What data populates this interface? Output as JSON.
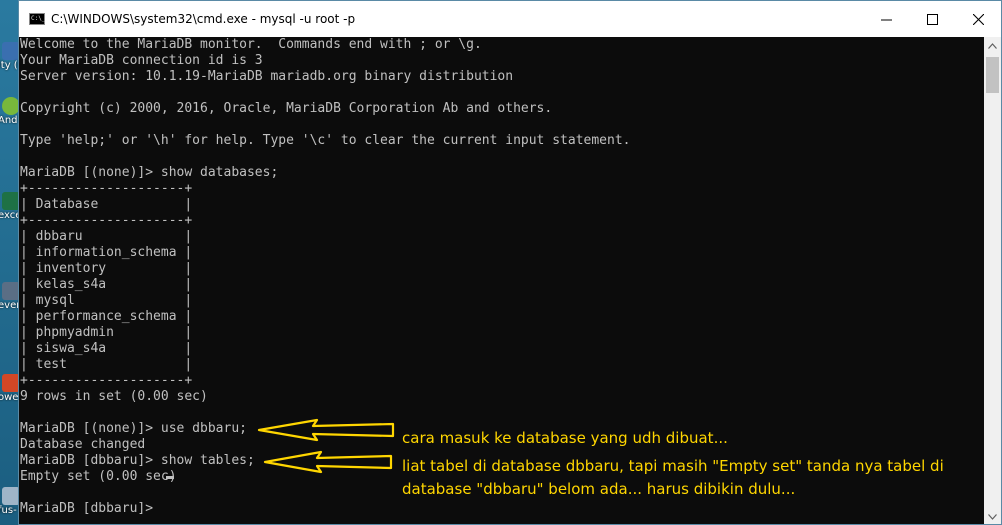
{
  "window": {
    "title": "C:\\WINDOWS\\system32\\cmd.exe - mysql  -u root -p",
    "icon_text": "C:\\_"
  },
  "desktop_icons": [
    {
      "label": "ity\n(64-",
      "color": "#3a6fb0"
    },
    {
      "label": "And\nStu",
      "color": "#78b83b"
    },
    {
      "label": "excel",
      "color": "#1e7145"
    },
    {
      "label": "even\nShor",
      "color": "#5a6e85"
    },
    {
      "label": "owe",
      "color": "#d24726"
    },
    {
      "label": "fus-\nShortcut",
      "color": "#9fb5c8"
    }
  ],
  "console_lines": [
    "Welcome to the MariaDB monitor.  Commands end with ; or \\g.",
    "Your MariaDB connection id is 3",
    "Server version: 10.1.19-MariaDB mariadb.org binary distribution",
    "",
    "Copyright (c) 2000, 2016, Oracle, MariaDB Corporation Ab and others.",
    "",
    "Type 'help;' or '\\h' for help. Type '\\c' to clear the current input statement.",
    "",
    "MariaDB [(none)]> show databases;",
    "+--------------------+",
    "| Database           |",
    "+--------------------+",
    "| dbbaru             |",
    "| information_schema |",
    "| inventory          |",
    "| kelas_s4a          |",
    "| mysql              |",
    "| performance_schema |",
    "| phpmyadmin         |",
    "| siswa_s4a          |",
    "| test               |",
    "+--------------------+",
    "9 rows in set (0.00 sec)",
    "",
    "MariaDB [(none)]> use dbbaru;",
    "Database changed",
    "MariaDB [dbbaru]> show tables;",
    "Empty set (0.00 sec)",
    "",
    "MariaDB [dbbaru]> "
  ],
  "annotations": [
    "cara masuk ke database yang udh dibuat...",
    "liat tabel di database dbbaru, tapi masih \"Empty set\" tanda nya tabel di",
    "database \"dbbaru\" belom ada... harus dibikin dulu..."
  ],
  "colors": {
    "console_bg": "#0c0c0c",
    "console_text": "#c0c0c0",
    "annotation": "#ffd600",
    "titlebar_bg": "#ffffff"
  }
}
